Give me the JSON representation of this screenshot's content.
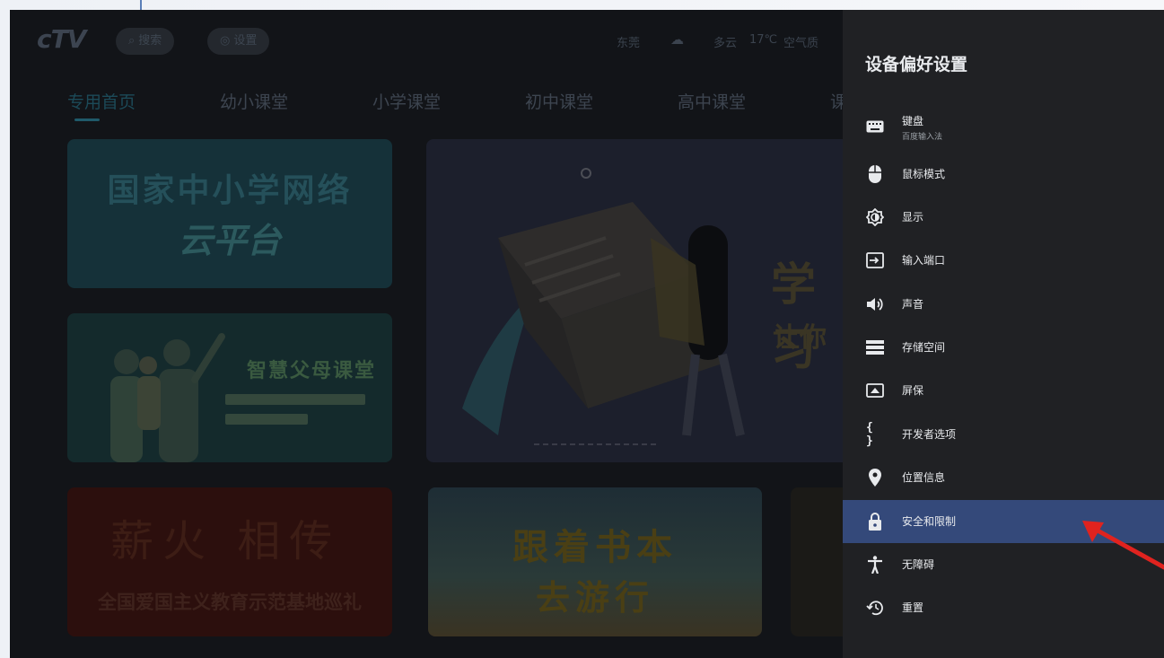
{
  "tv": {
    "logo": "cTV",
    "search_label": "搜索",
    "settings_label": "设置",
    "location": "东莞",
    "weather": "多云",
    "temperature": "17℃",
    "air_quality": "空气质",
    "tabs": [
      {
        "label": "专用首页",
        "active": true
      },
      {
        "label": "幼小课堂",
        "active": false
      },
      {
        "label": "小学课堂",
        "active": false
      },
      {
        "label": "初中课堂",
        "active": false
      },
      {
        "label": "高中课堂",
        "active": false
      },
      {
        "label": "课",
        "active": false
      }
    ],
    "cards": {
      "network_title": "国家中小学网络",
      "network_brand": "云平台",
      "parents_title": "智慧父母课堂",
      "study_title": "学习",
      "study_subtitle": "让你",
      "fire_title": "薪火 相传",
      "fire_subtitle": "全国爱国主义教育示范基地巡礼",
      "book_line1": "跟着书本",
      "book_line2": "去游行"
    }
  },
  "panel": {
    "title": "设备偏好设置",
    "items": [
      {
        "icon": "keyboard-icon",
        "label": "键盘",
        "sublabel": "百度输入法",
        "selected": false
      },
      {
        "icon": "mouse-icon",
        "label": "鼠标模式",
        "selected": false
      },
      {
        "icon": "display-icon",
        "label": "显示",
        "selected": false
      },
      {
        "icon": "input-port-icon",
        "label": "输入端口",
        "selected": false
      },
      {
        "icon": "speaker-icon",
        "label": "声音",
        "selected": false
      },
      {
        "icon": "storage-icon",
        "label": "存储空间",
        "selected": false
      },
      {
        "icon": "screensaver-icon",
        "label": "屏保",
        "selected": false
      },
      {
        "icon": "developer-braces-icon",
        "label": "开发者选项",
        "selected": false
      },
      {
        "icon": "location-pin-icon",
        "label": "位置信息",
        "selected": false
      },
      {
        "icon": "lock-icon",
        "label": "安全和限制",
        "selected": true
      },
      {
        "icon": "accessibility-icon",
        "label": "无障碍",
        "selected": false
      },
      {
        "icon": "reset-history-icon",
        "label": "重置",
        "selected": false
      }
    ]
  },
  "colors": {
    "panel_bg": "#202124",
    "selected_bg": "#34497a",
    "annotation_arrow": "#e0231f"
  }
}
